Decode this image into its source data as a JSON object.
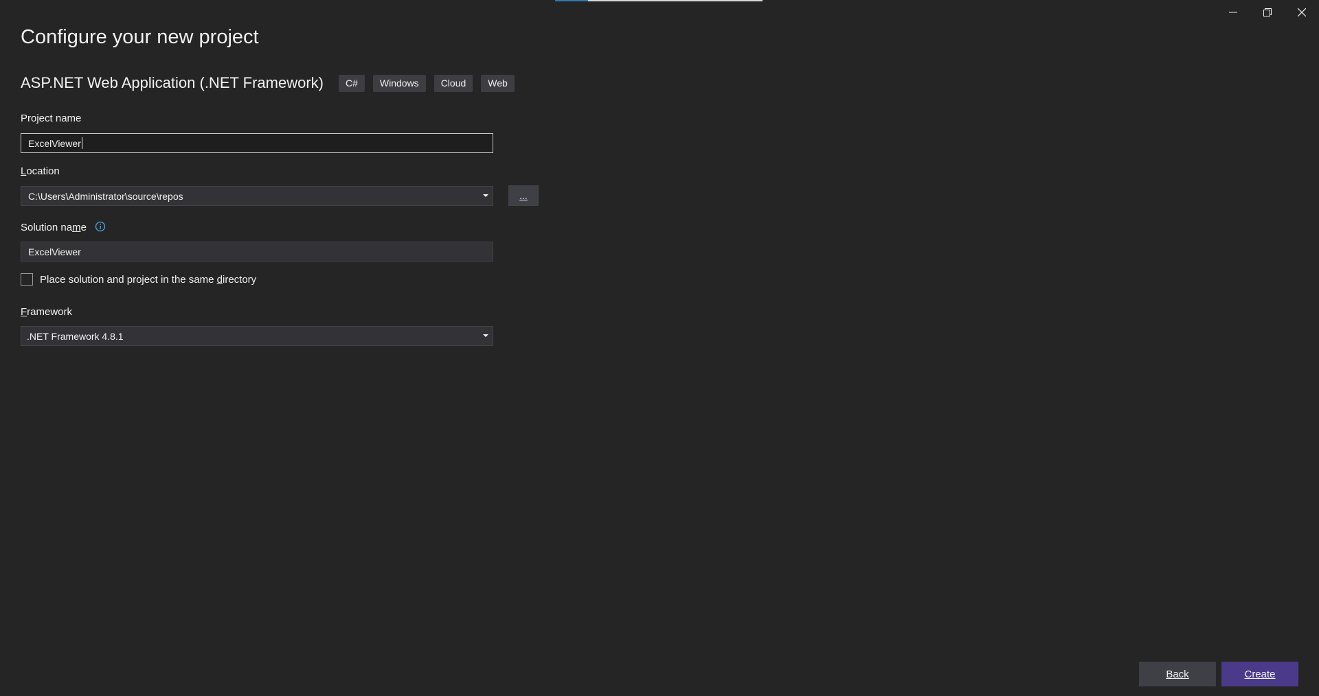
{
  "window": {
    "controls": [
      {
        "icon": "minimize-icon"
      },
      {
        "icon": "restore-icon"
      },
      {
        "icon": "close-icon"
      }
    ],
    "progress": 0.16
  },
  "page": {
    "title": "Configure your new project"
  },
  "template": {
    "name": "ASP.NET Web Application (.NET Framework)",
    "tags": [
      "C#",
      "Windows",
      "Cloud",
      "Web"
    ]
  },
  "form": {
    "project_name": {
      "label": "Project name",
      "value": "ExcelViewer"
    },
    "location": {
      "label": "Location",
      "value": "C:\\Users\\Administrator\\source\\repos",
      "browse_label": "..."
    },
    "solution_name": {
      "label_prefix": "Solution na",
      "label_underlined": "m",
      "label_suffix": "e",
      "value": "ExcelViewer",
      "info_icon": "info-icon"
    },
    "same_directory": {
      "label_prefix": "Place solution and project in the same ",
      "label_underlined": "d",
      "label_suffix": "irectory",
      "checked": false
    },
    "framework": {
      "label": "Framework",
      "value": ".NET Framework 4.8.1"
    }
  },
  "footer": {
    "back_label": "Back",
    "create_label": "Create"
  },
  "colors": {
    "background": "#252526",
    "create_button": "#4b3a8a",
    "info_icon": "#4fa8e0"
  }
}
